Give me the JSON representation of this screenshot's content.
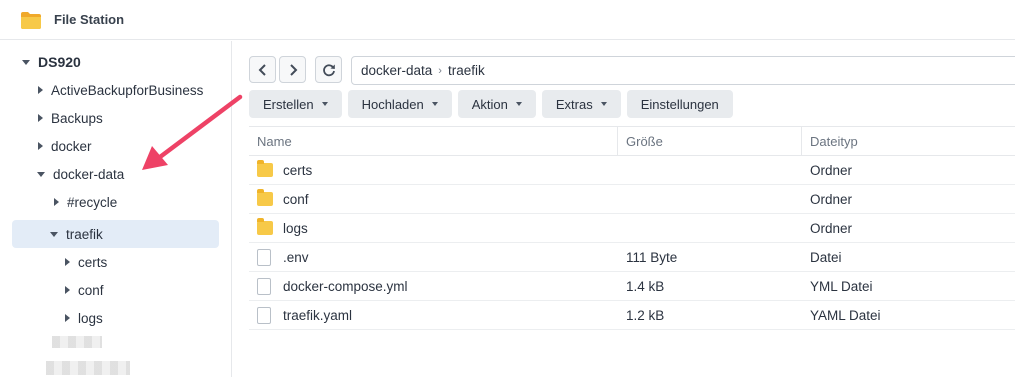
{
  "app": {
    "title": "File Station",
    "icon": "folder-icon"
  },
  "sidebar": {
    "root": "DS920",
    "items": [
      {
        "label": "ActiveBackupforBusiness"
      },
      {
        "label": "Backups"
      },
      {
        "label": "docker"
      },
      {
        "label": "docker-data"
      },
      {
        "label": "#recycle"
      },
      {
        "label": "traefik"
      },
      {
        "label": "certs"
      },
      {
        "label": "conf"
      },
      {
        "label": "logs"
      }
    ]
  },
  "nav": {
    "back": "back-icon",
    "forward": "forward-icon",
    "refresh": "refresh-icon"
  },
  "path": {
    "segments": [
      "docker-data",
      "traefik"
    ]
  },
  "toolbar": {
    "create": "Erstellen",
    "upload": "Hochladen",
    "action": "Aktion",
    "extras": "Extras",
    "settings": "Einstellungen"
  },
  "table": {
    "columns": [
      "Name",
      "Größe",
      "Dateityp"
    ],
    "rows": [
      {
        "name": "certs",
        "size": "",
        "type": "Ordner",
        "kind": "folder"
      },
      {
        "name": "conf",
        "size": "",
        "type": "Ordner",
        "kind": "folder"
      },
      {
        "name": "logs",
        "size": "",
        "type": "Ordner",
        "kind": "folder"
      },
      {
        "name": ".env",
        "size": "111 Byte",
        "type": "Datei",
        "kind": "file"
      },
      {
        "name": "docker-compose.yml",
        "size": "1.4 kB",
        "type": "YML Datei",
        "kind": "file"
      },
      {
        "name": "traefik.yaml",
        "size": "1.2 kB",
        "type": "YAML Datei",
        "kind": "file"
      }
    ]
  },
  "colors": {
    "accent_arrow": "#ee4266",
    "selected": "#e3ecf7",
    "folder": "#f7c948"
  }
}
